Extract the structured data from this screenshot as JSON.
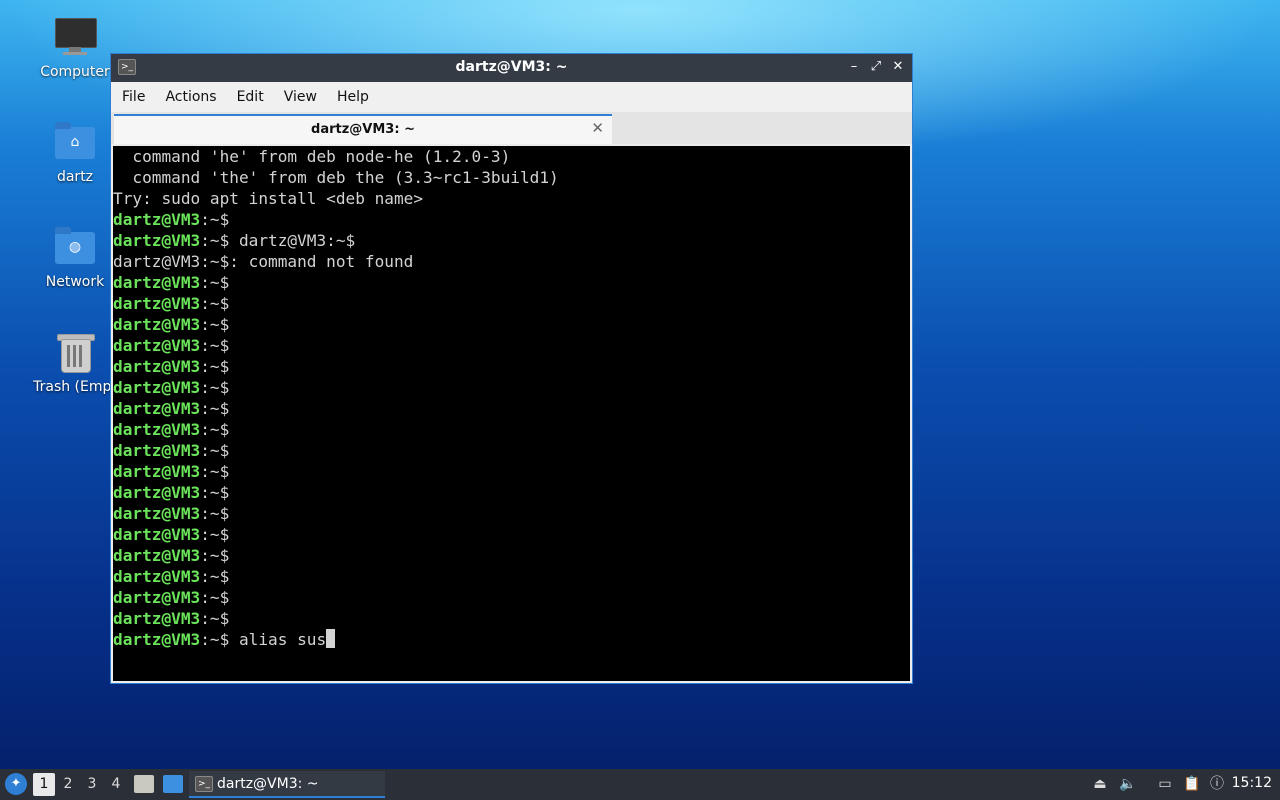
{
  "desktop": {
    "icons": [
      {
        "label": "Computer"
      },
      {
        "label": "dartz"
      },
      {
        "label": "Network"
      },
      {
        "label": "Trash (Empt"
      }
    ]
  },
  "window": {
    "title": "dartz@VM3: ~",
    "menu": [
      "File",
      "Actions",
      "Edit",
      "View",
      "Help"
    ],
    "tab_label": "dartz@VM3: ~",
    "controls": {
      "minimize": "–",
      "maximize": "⤢",
      "close": "✕"
    },
    "tab_close": "✕"
  },
  "terminal": {
    "lines": [
      {
        "prompt": "",
        "text": "  command 'he' from deb node-he (1.2.0-3)"
      },
      {
        "prompt": "",
        "text": "  command 'the' from deb the (3.3~rc1-3build1)"
      },
      {
        "prompt": "",
        "text": "Try: sudo apt install <deb name>"
      },
      {
        "prompt": "dartz@VM3",
        "text": ":~$"
      },
      {
        "prompt": "dartz@VM3",
        "text": ":~$ dartz@VM3:~$"
      },
      {
        "prompt": "",
        "text": "dartz@VM3:~$: command not found"
      },
      {
        "prompt": "dartz@VM3",
        "text": ":~$"
      },
      {
        "prompt": "dartz@VM3",
        "text": ":~$"
      },
      {
        "prompt": "dartz@VM3",
        "text": ":~$"
      },
      {
        "prompt": "dartz@VM3",
        "text": ":~$"
      },
      {
        "prompt": "dartz@VM3",
        "text": ":~$"
      },
      {
        "prompt": "dartz@VM3",
        "text": ":~$"
      },
      {
        "prompt": "dartz@VM3",
        "text": ":~$"
      },
      {
        "prompt": "dartz@VM3",
        "text": ":~$"
      },
      {
        "prompt": "dartz@VM3",
        "text": ":~$"
      },
      {
        "prompt": "dartz@VM3",
        "text": ":~$"
      },
      {
        "prompt": "dartz@VM3",
        "text": ":~$"
      },
      {
        "prompt": "dartz@VM3",
        "text": ":~$"
      },
      {
        "prompt": "dartz@VM3",
        "text": ":~$"
      },
      {
        "prompt": "dartz@VM3",
        "text": ":~$"
      },
      {
        "prompt": "dartz@VM3",
        "text": ":~$"
      },
      {
        "prompt": "dartz@VM3",
        "text": ":~$"
      },
      {
        "prompt": "dartz@VM3",
        "text": ":~$"
      },
      {
        "prompt": "dartz@VM3",
        "text": ":~$ alias sus",
        "cursor": true
      }
    ]
  },
  "taskbar": {
    "workspaces": [
      "1",
      "2",
      "3",
      "4"
    ],
    "active_workspace": "1",
    "task_label": "dartz@VM3: ~",
    "clock": "15:12",
    "tray_icons": [
      "eject-icon",
      "volume-icon",
      "network-icon",
      "clipboard-icon",
      "notification-icon"
    ]
  },
  "colors": {
    "prompt": "#6be35a",
    "accent": "#2f7fd4",
    "terminal_bg": "#000000",
    "terminal_fg": "#d3d3d3"
  }
}
